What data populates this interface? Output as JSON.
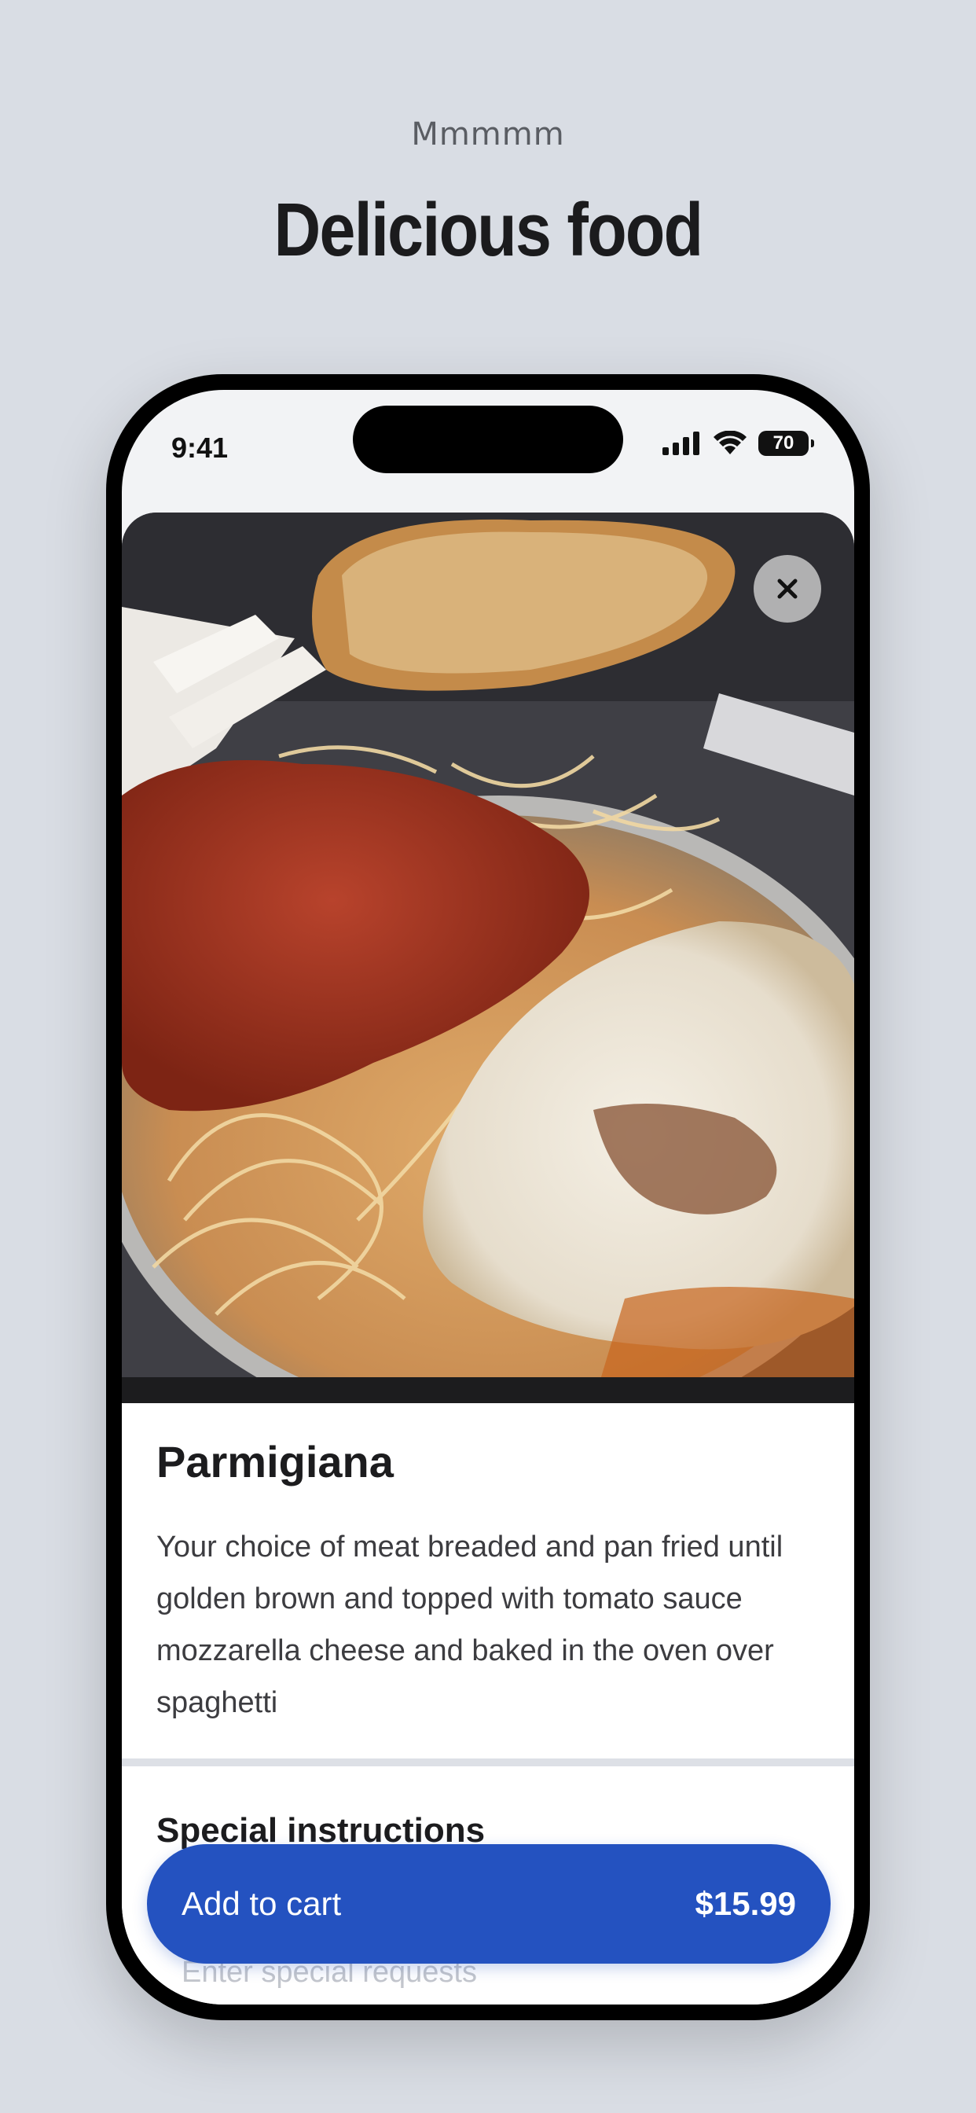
{
  "header": {
    "kicker": "Mmmmm",
    "title": "Delicious food"
  },
  "status_bar": {
    "time": "9:41",
    "battery": "70"
  },
  "item": {
    "name": "Parmigiana",
    "description": "Your choice of meat breaded and pan fried until golden brown and topped with tomato sauce mozzarella cheese and baked in the oven over spaghetti"
  },
  "special_instructions": {
    "title": "Special instructions",
    "placeholder": "Enter special requests"
  },
  "cart_button": {
    "label": "Add to cart",
    "price": "$15.99"
  },
  "colors": {
    "background": "#d9dde4",
    "accent": "#2452c0"
  },
  "icons": [
    "signal-icon",
    "wifi-icon",
    "battery-icon",
    "close-icon"
  ]
}
